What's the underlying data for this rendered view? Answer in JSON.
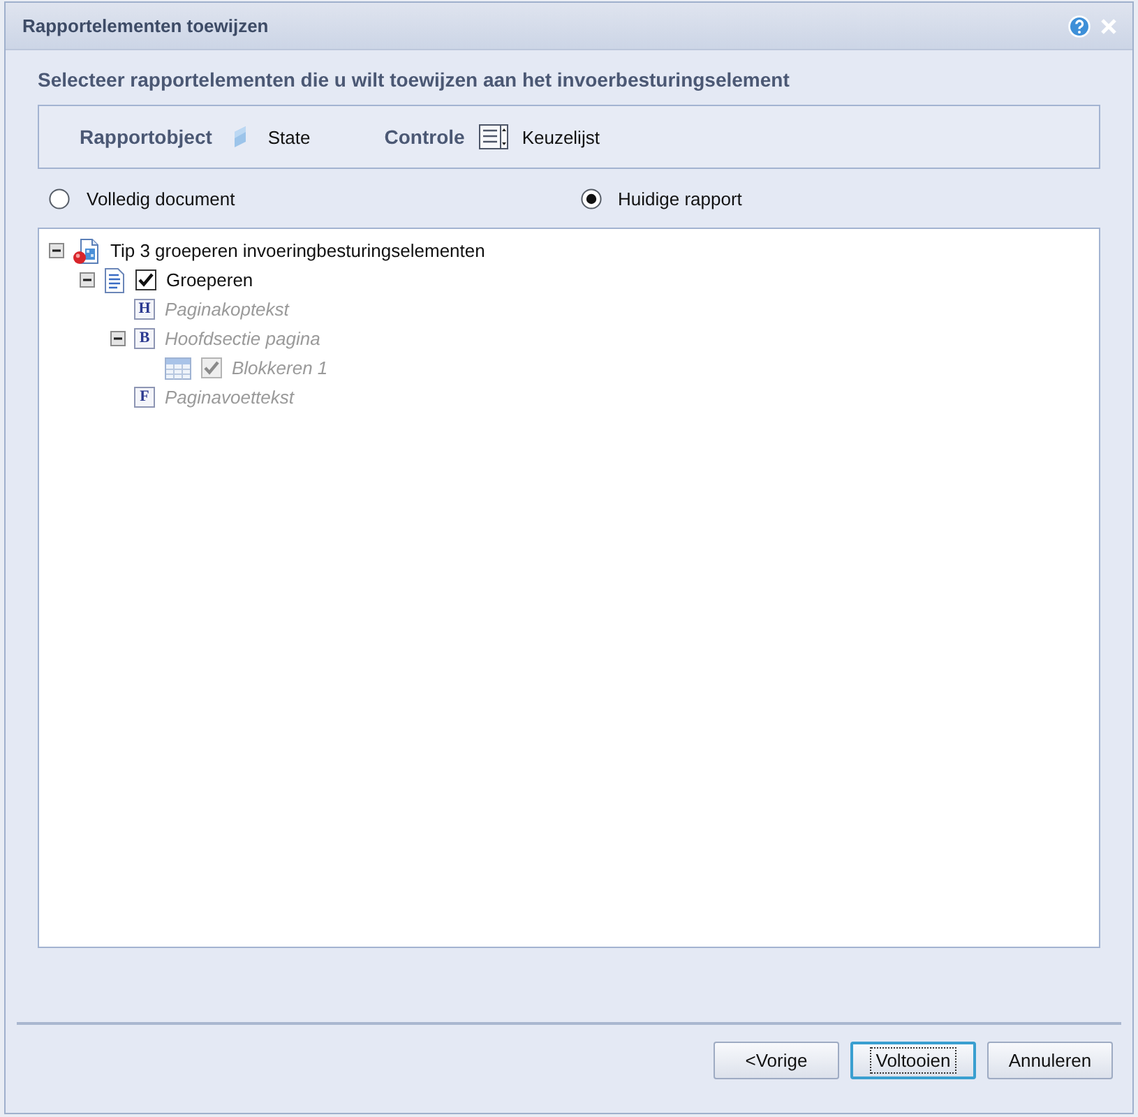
{
  "window": {
    "title": "Rapportelementen toewijzen"
  },
  "instruction": "Selecteer rapportelementen die u wilt toewijzen aan het invoerbesturingselement",
  "info": [
    {
      "kind": "object",
      "label": "Rapportobject",
      "value": "State"
    },
    {
      "kind": "list",
      "label": "Controle",
      "value": "Keuzelijst"
    }
  ],
  "scope": [
    {
      "label": "Volledig document",
      "selected": false
    },
    {
      "label": "Huidige rapport",
      "selected": true
    }
  ],
  "tree": [
    {
      "kind": "report",
      "label": "Tip 3 groeperen invoeringbesturingselementen",
      "expanded": true,
      "disabled": false,
      "children": [
        {
          "kind": "document",
          "label": "Groeperen",
          "expanded": true,
          "checked": true,
          "disabled": false,
          "children": [
            {
              "kind": "section",
              "letter": "H",
              "label": "Paginakoptekst",
              "disabled": true
            },
            {
              "kind": "section",
              "letter": "B",
              "label": "Hoofdsectie pagina",
              "expanded": true,
              "disabled": true,
              "children": [
                {
                  "kind": "table",
                  "label": "Blokkeren 1",
                  "checked": true,
                  "disabled": true
                }
              ]
            },
            {
              "kind": "section",
              "letter": "F",
              "label": "Paginavoettekst",
              "disabled": true
            }
          ]
        }
      ]
    }
  ],
  "buttons": [
    {
      "label": "<Vorige",
      "focused": false
    },
    {
      "label": "Voltooien",
      "focused": true
    },
    {
      "label": "Annuleren",
      "focused": false
    }
  ]
}
